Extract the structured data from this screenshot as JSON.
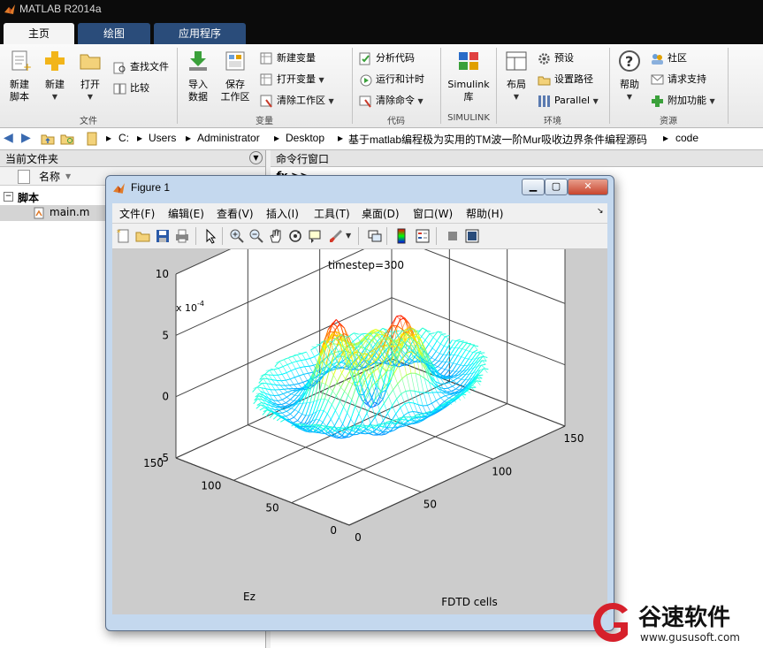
{
  "window": {
    "title": "MATLAB R2014a"
  },
  "tabs": [
    {
      "label": "主页",
      "active": true
    },
    {
      "label": "绘图",
      "active": false
    },
    {
      "label": "应用程序",
      "active": false
    }
  ],
  "ribbon": {
    "file": {
      "group_label": "文件",
      "new_script": [
        "新建",
        "脚本"
      ],
      "new": "新建",
      "open": "打开",
      "find_files": "查找文件",
      "compare": "比较"
    },
    "variable": {
      "group_label": "变量",
      "import": [
        "导入",
        "数据"
      ],
      "save_ws": [
        "保存",
        "工作区"
      ],
      "new_var": "新建变量",
      "open_var": "打开变量",
      "clear_ws": "清除工作区"
    },
    "code": {
      "group_label": "代码",
      "analyze": "分析代码",
      "run_time": "运行和计时",
      "clear_cmd": "清除命令"
    },
    "simulink": {
      "group_label": "SIMULINK",
      "lib": [
        "Simulink",
        "库"
      ]
    },
    "env": {
      "group_label": "环境",
      "layout": "布局",
      "prefs": "预设",
      "set_path": "设置路径",
      "parallel": "Parallel"
    },
    "resources": {
      "group_label": "资源",
      "help": "帮助",
      "community": "社区",
      "request_support": "请求支持",
      "addons": "附加功能"
    }
  },
  "address": {
    "segments": [
      "C:",
      "Users",
      "Administrator",
      "Desktop",
      "基于matlab编程极为实用的TM波一阶Mur吸收边界条件编程源码",
      "code"
    ]
  },
  "current_folder": {
    "title": "当前文件夹",
    "column": "名称",
    "group": "脚本",
    "files": [
      "main.m"
    ]
  },
  "command_window": {
    "title": "命令行窗口",
    "prompt": "fx >>"
  },
  "figure": {
    "title": "Figure 1",
    "menu": [
      "文件(F)",
      "编辑(E)",
      "查看(V)",
      "插入(I)",
      "工具(T)",
      "桌面(D)",
      "窗口(W)",
      "帮助(H)"
    ],
    "toolbar_icons": [
      "new-figure-icon",
      "open-icon",
      "save-icon",
      "print-icon",
      "pointer-icon",
      "zoom-in-icon",
      "zoom-out-icon",
      "pan-icon",
      "rotate-icon",
      "data-cursor-icon",
      "brush-icon",
      "link-icon",
      "colorbar-icon",
      "legend-icon",
      "hide-plot-tools-icon",
      "show-plot-tools-icon"
    ]
  },
  "chart_data": {
    "type": "surface",
    "title": "timestep=300",
    "xlabel": "FDTD cells",
    "ylabel": "Ez",
    "zlabel": "",
    "z_multiplier": "x 10^-4",
    "z_multiplier_base": "x 10",
    "z_multiplier_exp": "-4",
    "xticks": [
      0,
      50,
      100,
      150
    ],
    "yticks": [
      0,
      50,
      100,
      150
    ],
    "zticks": [
      -5,
      0,
      5,
      10
    ],
    "xlim": [
      0,
      150
    ],
    "ylim": [
      0,
      150
    ],
    "zlim": [
      -5,
      10
    ],
    "z_peak": 7.5,
    "z_min": -5,
    "colormap": "jet",
    "grid": true
  },
  "watermark": {
    "text": "谷速软件",
    "url": "www.gususoft.com"
  },
  "colors": {
    "accent": "#2a4c7a",
    "brand": "#d6202b"
  }
}
